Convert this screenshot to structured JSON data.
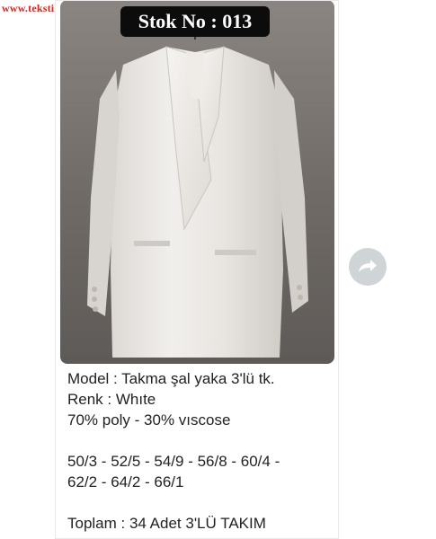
{
  "watermark": "www.tekstilportal.com",
  "stock_badge": "Stok No : 013",
  "caption": {
    "model": "Model : Takma şal yaka 3'lü tk.",
    "color": "Renk : Whıte",
    "fabric": "70% poly - 30% vıscose",
    "sizes_line1": "50/3 - 52/5 - 54/9 - 56/8 - 60/4 -",
    "sizes_line2": "62/2 - 64/2 - 66/1",
    "total": "Toplam : 34 Adet  3'LÜ TAKIM"
  },
  "icons": {
    "forward": "forward-arrow-icon",
    "photo": "white-suit-jacket-photo"
  },
  "colors": {
    "watermark": "#e3211c",
    "badge_bg": "#0c0c0c",
    "forward_bg": "#cfd4d6",
    "text": "#222222"
  }
}
